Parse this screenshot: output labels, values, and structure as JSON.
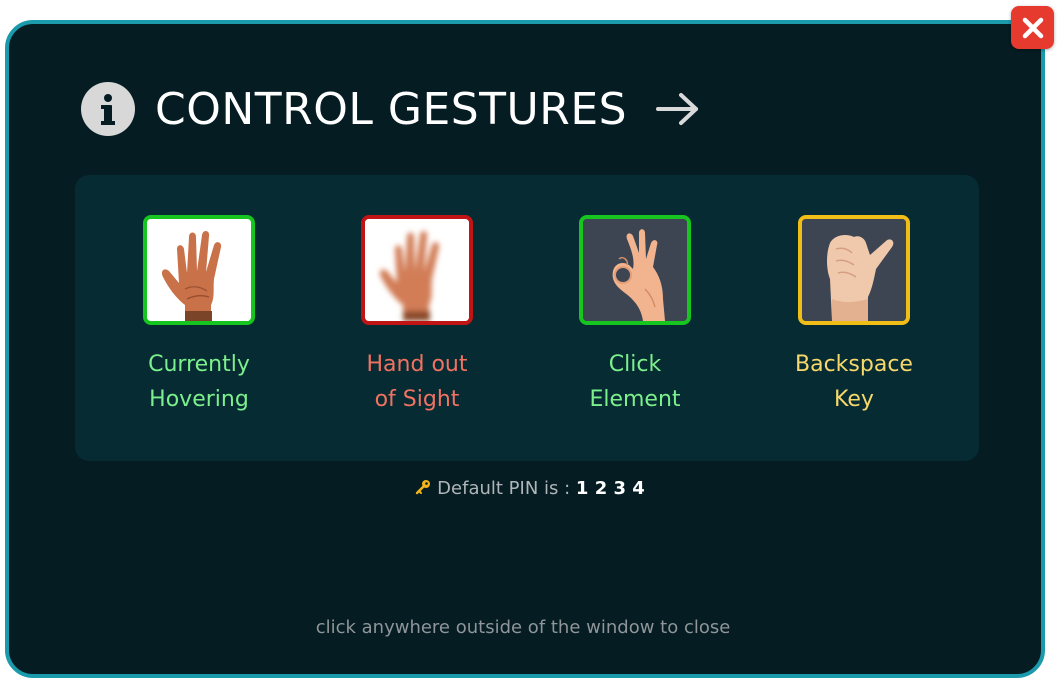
{
  "header": {
    "title": "CONTROL GESTURES",
    "info_icon": "info-icon",
    "arrow_icon": "arrow-right-icon"
  },
  "close_button": {
    "icon": "close-icon",
    "color": "#e63a2e"
  },
  "gestures": [
    {
      "line1": "Currently",
      "line2": "Hovering",
      "color": "#7bf08c",
      "border": "#16c51f",
      "icon": "open-palm-hand-icon"
    },
    {
      "line1": "Hand out",
      "line2": "of Sight",
      "color": "#f27262",
      "border": "#c11515",
      "icon": "blurred-open-palm-hand-icon"
    },
    {
      "line1": "Click",
      "line2": "Element",
      "color": "#7bf08c",
      "border": "#16c51f",
      "icon": "ok-sign-hand-icon"
    },
    {
      "line1": "Backspace",
      "line2": "Key",
      "color": "#f6d86b",
      "border": "#f1bd17",
      "icon": "thumb-point-hand-icon"
    }
  ],
  "pin": {
    "label": "Default PIN is :",
    "value": "1 2 3 4",
    "icon": "key-icon"
  },
  "footer": {
    "hint": "click anywhere outside of the window to close"
  },
  "colors": {
    "modal_bg": "#041c22",
    "modal_border": "#1a9aaa",
    "panel_bg": "#062b33"
  }
}
